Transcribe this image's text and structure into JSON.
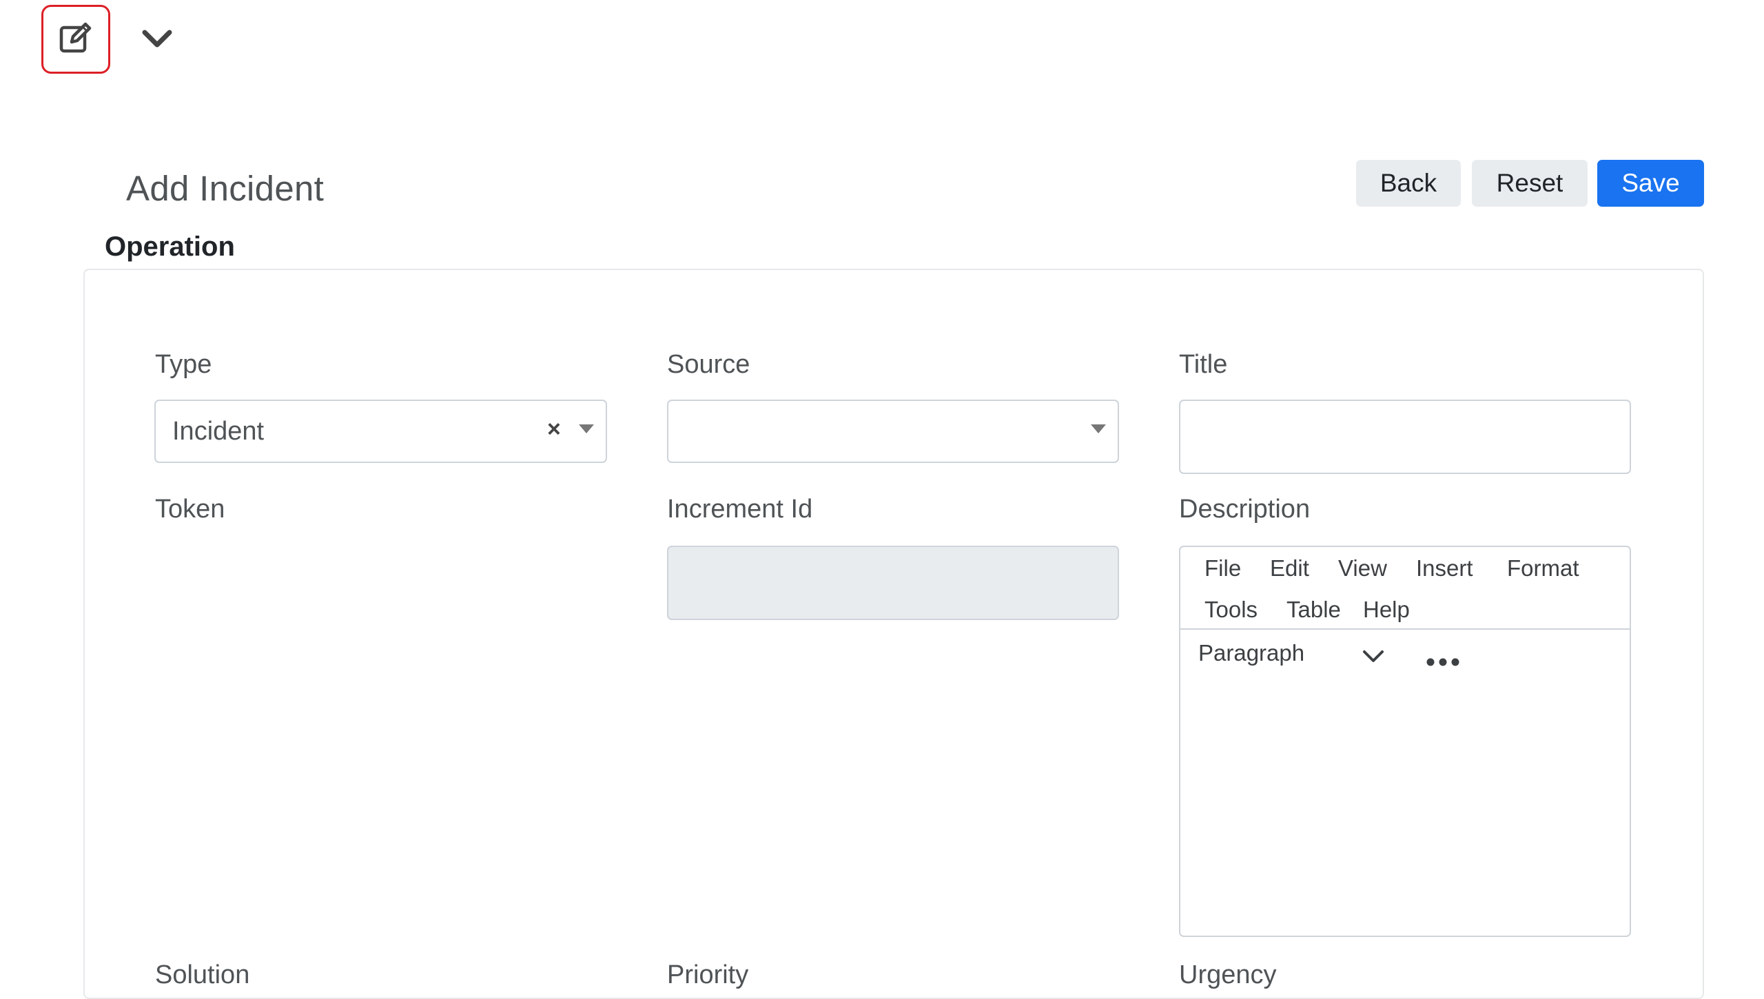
{
  "toolbar": {
    "edit_icon": "edit-square-icon",
    "chevron_icon": "chevron-down-icon"
  },
  "page": {
    "title": "Add Incident",
    "section": "Operation"
  },
  "actions": {
    "back": "Back",
    "reset": "Reset",
    "save": "Save"
  },
  "fields": {
    "type": {
      "label": "Type",
      "value": "Incident"
    },
    "source": {
      "label": "Source",
      "value": ""
    },
    "title": {
      "label": "Title",
      "value": ""
    },
    "token": {
      "label": "Token"
    },
    "increment_id": {
      "label": "Increment Id",
      "value": ""
    },
    "description": {
      "label": "Description",
      "menu": [
        "File",
        "Edit",
        "View",
        "Insert",
        "Format",
        "Tools",
        "Table",
        "Help"
      ],
      "block_format": "Paragraph"
    },
    "solution": {
      "label": "Solution"
    },
    "priority": {
      "label": "Priority"
    },
    "urgency": {
      "label": "Urgency"
    }
  },
  "colors": {
    "primary": "#1a73f0",
    "highlight_border": "#dc1f26",
    "light_button": "#e9ecef"
  }
}
